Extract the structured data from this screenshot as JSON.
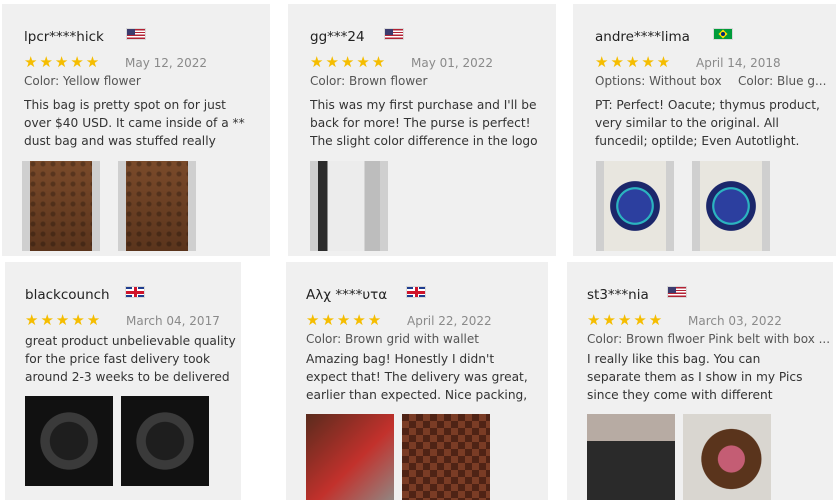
{
  "reviews": [
    {
      "username": "lpcr****hick",
      "flag": "us",
      "stars": "★★★★★",
      "date": "May 12, 2022",
      "option1": "Color: Yellow flower",
      "option2": "",
      "text": "This bag is pretty spot on for just over $40 USD. It came inside of a ** dust bag and was stuffed really nicely to prevent",
      "photos": [
        "bag-brown",
        "bag-brown"
      ]
    },
    {
      "username": "gg***24",
      "flag": "us",
      "stars": "★★★★★",
      "date": "May 01, 2022",
      "option1": "Color: Brown flower",
      "option2": "",
      "text": "This was my first purchase and I'll be back for more! The purse is perfect! The slight color difference in the logo is the",
      "photos": [
        "white-bag"
      ]
    },
    {
      "username": "andre****lima",
      "flag": "br",
      "stars": "★★★★★",
      "date": "April 14, 2018",
      "option1": "Options: Without box",
      "option2": "Color: Blue g...",
      "text": "PT: Perfect! Oacute; thymus product, very similar to the original. All funcedil; optilde; Even Autotlight. The Satilde",
      "photos": [
        "watch-blue",
        "watch-blue"
      ]
    },
    {
      "username": "blackcounch",
      "flag": "gb",
      "stars": "★★★★★",
      "date": "March 04, 2017",
      "option1": "",
      "option2": "",
      "text": "great product unbelievable quality for the price fast delivery took around 2-3 weeks to be delivered to the UK the",
      "photos": [
        "watch-dark",
        "watch-dark"
      ]
    },
    {
      "username": "Αλχ ****υτα",
      "flag": "gb",
      "stars": "★★★★★",
      "date": "April 22, 2022",
      "option1": "Color: Brown grid with wallet",
      "option2": "",
      "text": "Amazing bag! Honestly I didn't expect that! The delivery was great, earlier than expected. Nice packing, protected. I'm",
      "photos": [
        "red-bag",
        "checker"
      ]
    },
    {
      "username": "st3***nia",
      "flag": "us",
      "stars": "★★★★★",
      "date": "March 03, 2022",
      "option1": "Color: Brown flwoer Pink belt with box ...",
      "option2": "",
      "text": "I really like this bag. You can separate them as I show in my Pics since they come with different chains. I LOVE IT!",
      "photos": [
        "person",
        "pink-bag"
      ]
    }
  ]
}
